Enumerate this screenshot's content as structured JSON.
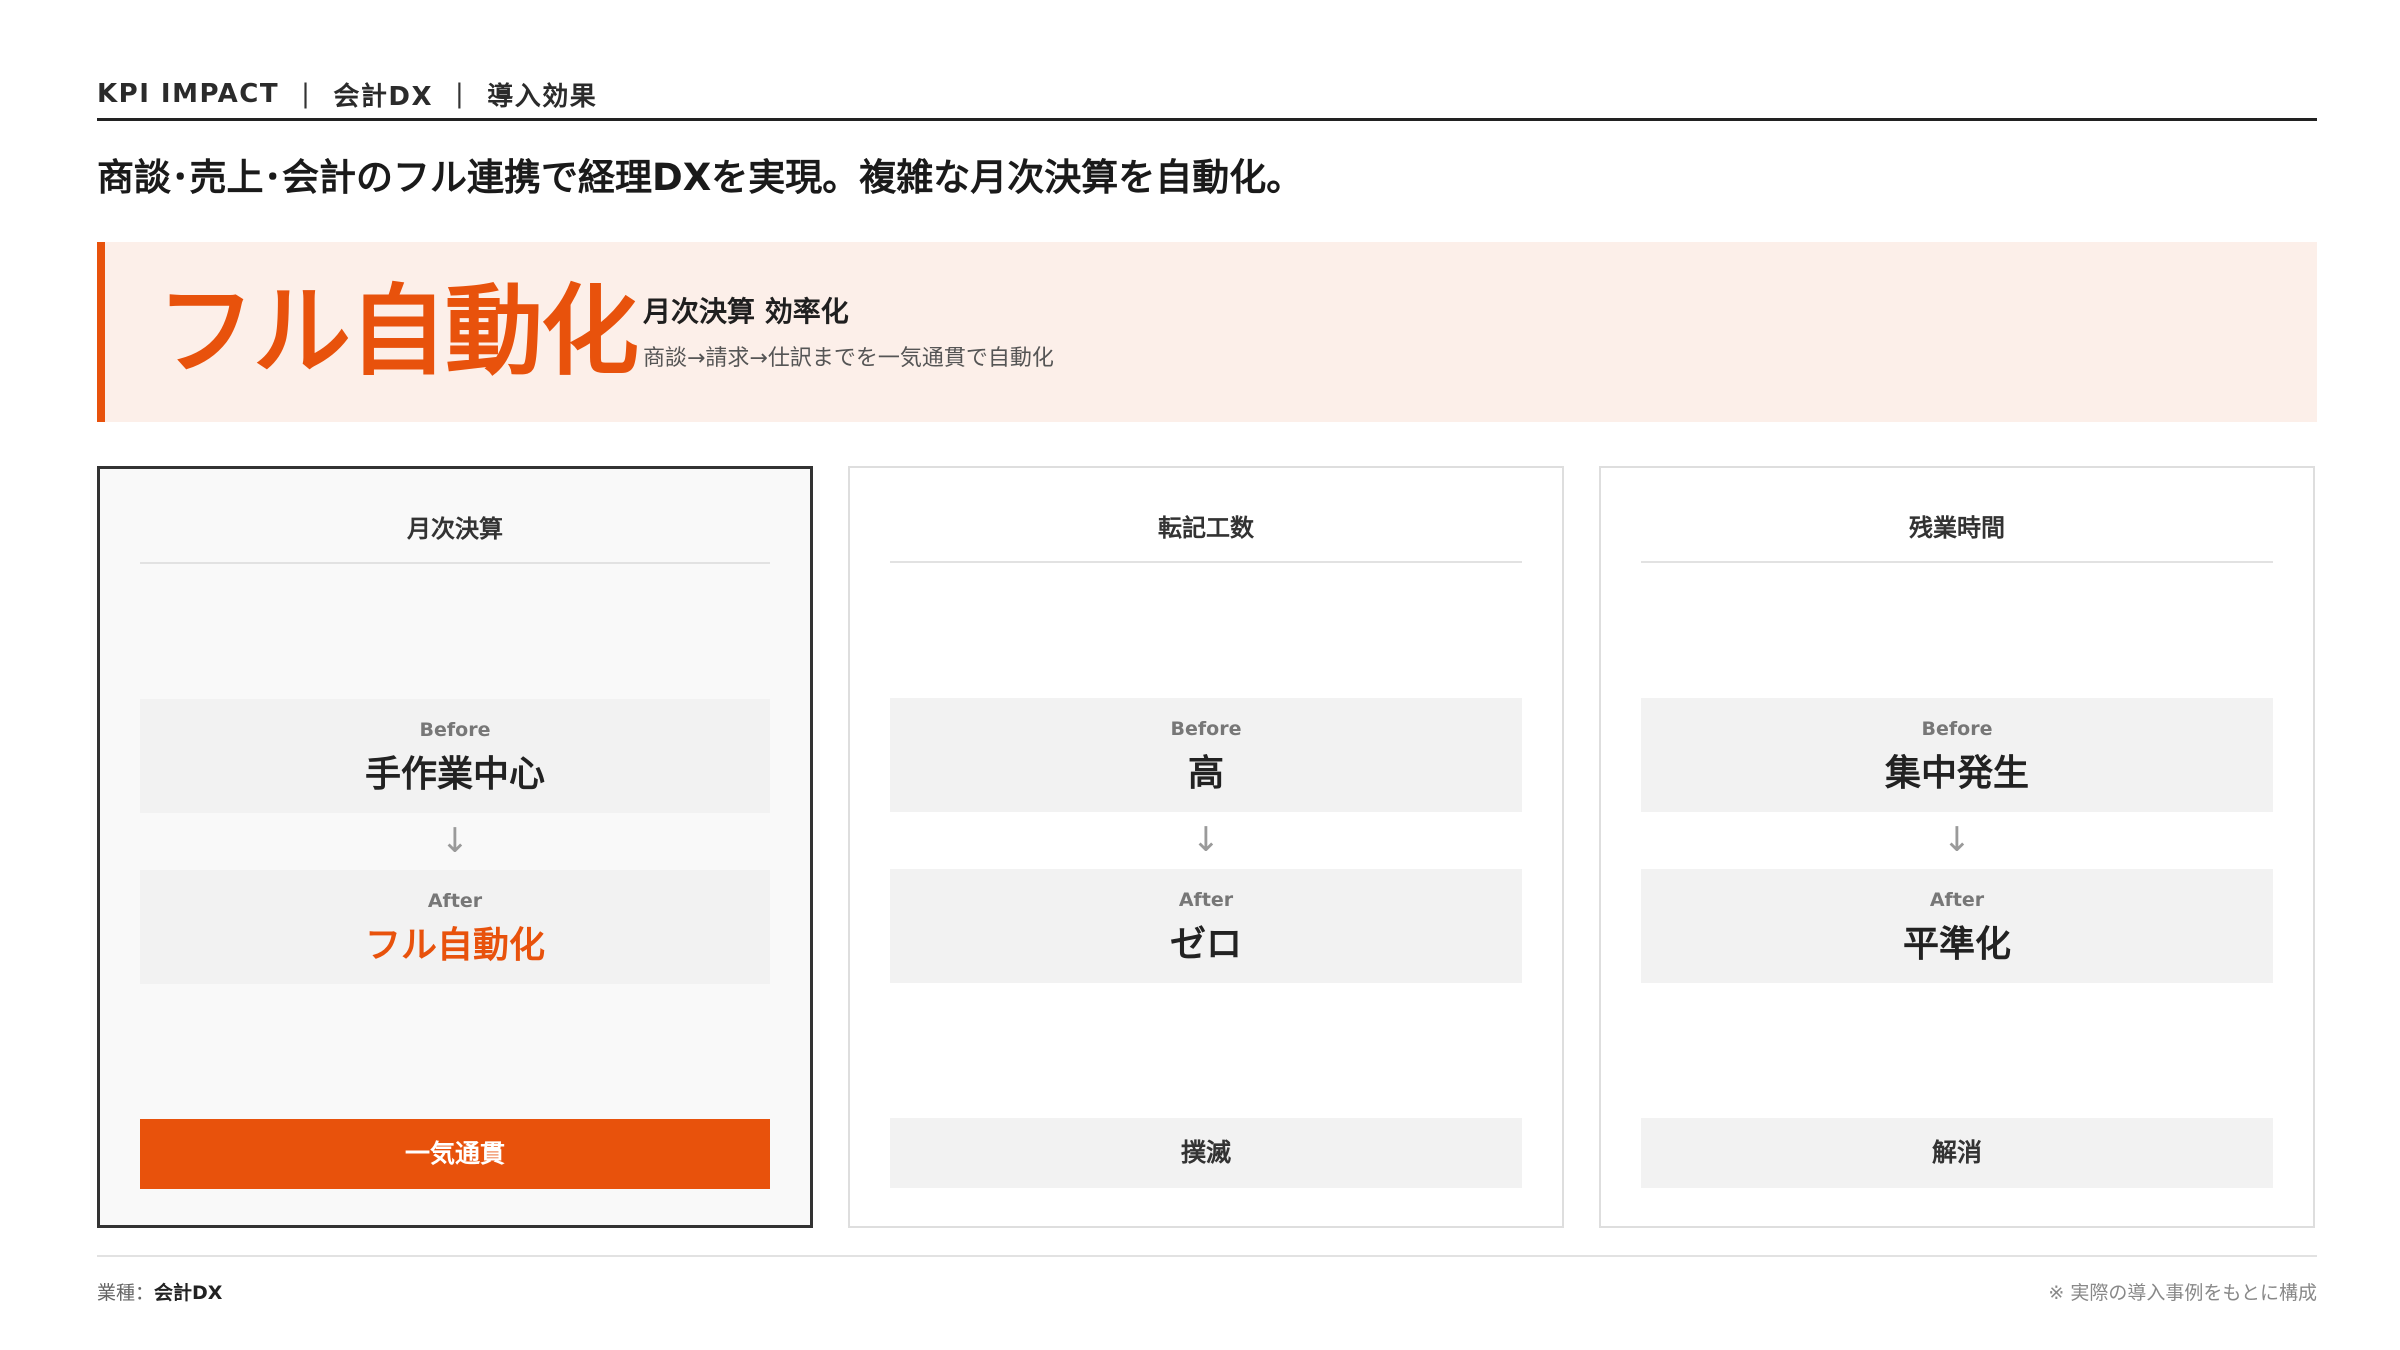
{
  "header": {
    "kicker": [
      "KPI IMPACT",
      "会計DX",
      "導入効果"
    ],
    "separator": "|",
    "headline": "商談･売上･会計のフル連携で経理DXを実現。複雑な月次決算を自動化。"
  },
  "hero": {
    "big_text": "フル自動化",
    "title": "月次決算 効率化",
    "description": "商談→請求→仕訳までを一気通貫で自動化"
  },
  "cards": [
    {
      "title": "月次決算",
      "before_label": "Before",
      "before_value": "手作業中心",
      "arrow": "↓",
      "after_label": "After",
      "after_value": "フル自動化",
      "tag": "一気通貫"
    },
    {
      "title": "転記工数",
      "before_label": "Before",
      "before_value": "高",
      "arrow": "↓",
      "after_label": "After",
      "after_value": "ゼロ",
      "tag": "撲滅"
    },
    {
      "title": "残業時間",
      "before_label": "Before",
      "before_value": "集中発生",
      "arrow": "↓",
      "after_label": "After",
      "after_value": "平準化",
      "tag": "解消"
    }
  ],
  "footer": {
    "industry_label": "業種：",
    "industry_value": "会計DX",
    "note": "※ 実際の導入事例をもとに構成"
  },
  "colors": {
    "accent": "#e8520c",
    "hero_bg": "#fcefe9",
    "box_bg": "#f2f2f2"
  }
}
